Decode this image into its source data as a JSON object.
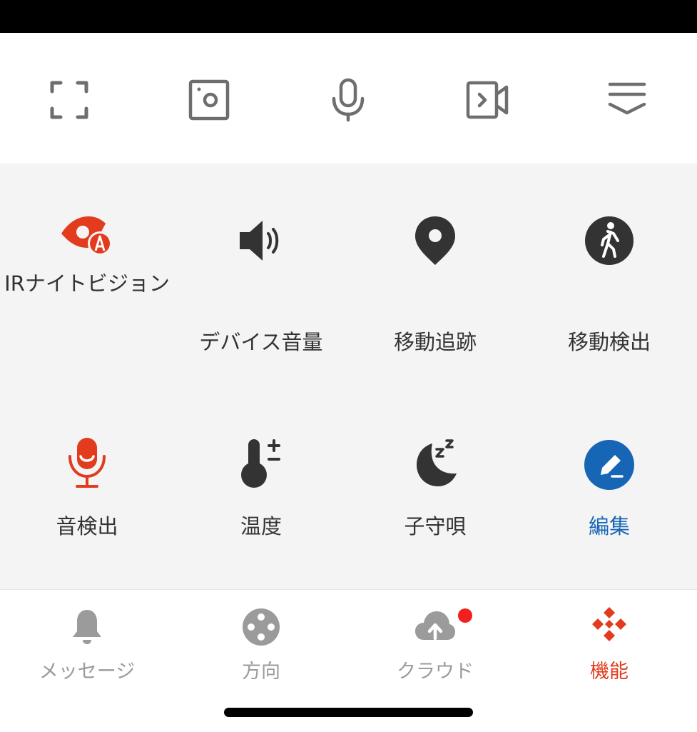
{
  "colors": {
    "status_bar": "#000000",
    "panel_bg": "#f4f4f4",
    "icon_gray": "#6e6e6e",
    "icon_dark": "#333333",
    "accent_red": "#e23b1d",
    "edit_blue": "#1766b6",
    "tab_inactive": "#9b9b9b"
  },
  "toolbar": {
    "items": [
      {
        "name": "fullscreen",
        "icon": "fullscreen-icon"
      },
      {
        "name": "snapshot",
        "icon": "camera-snapshot-icon"
      },
      {
        "name": "talk",
        "icon": "microphone-icon"
      },
      {
        "name": "record",
        "icon": "video-record-icon"
      },
      {
        "name": "collapse",
        "icon": "collapse-down-icon"
      }
    ]
  },
  "features": [
    {
      "label": "IRナイトビジョン",
      "icon": "ir-night-vision-icon"
    },
    {
      "label": "デバイス音量",
      "icon": "speaker-volume-icon"
    },
    {
      "label": "移動追跡",
      "icon": "location-pin-icon"
    },
    {
      "label": "移動検出",
      "icon": "walking-person-icon"
    },
    {
      "label": "音検出",
      "icon": "microphone-sound-icon"
    },
    {
      "label": "温度",
      "icon": "thermometer-icon"
    },
    {
      "label": "子守唄",
      "icon": "moon-sleep-icon"
    },
    {
      "label": "編集",
      "icon": "edit-pencil-icon"
    }
  ],
  "tabs": [
    {
      "label": "メッセージ",
      "icon": "bell-icon"
    },
    {
      "label": "方向",
      "icon": "direction-pad-icon"
    },
    {
      "label": "クラウド",
      "icon": "cloud-upload-icon",
      "has_badge": true
    },
    {
      "label": "機能",
      "icon": "features-grid-icon",
      "active": true
    }
  ]
}
